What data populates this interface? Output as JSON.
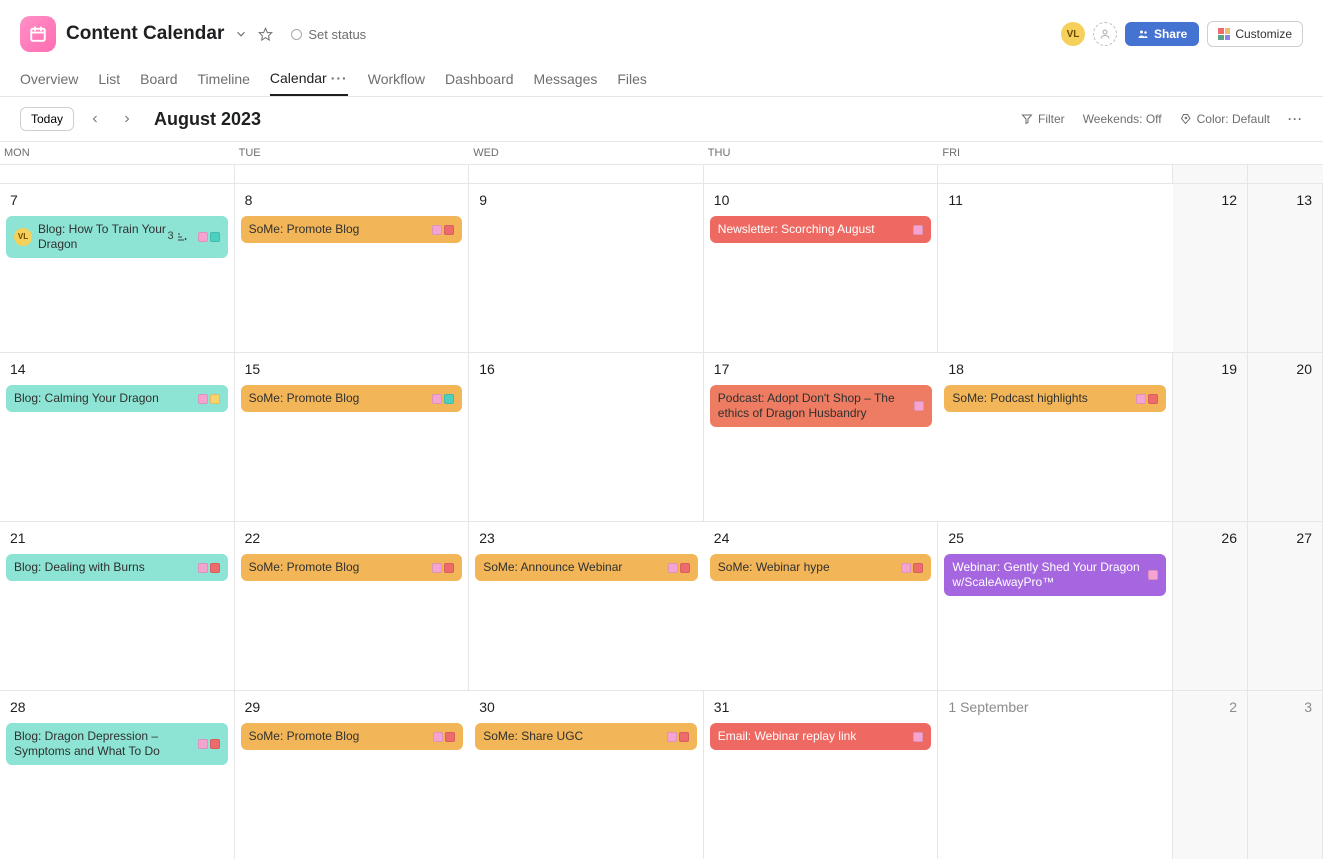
{
  "header": {
    "title": "Content Calendar",
    "status": "Set status",
    "avatar_initials": "VL",
    "share_label": "Share",
    "customize_label": "Customize"
  },
  "tabs": [
    {
      "label": "Overview"
    },
    {
      "label": "List"
    },
    {
      "label": "Board"
    },
    {
      "label": "Timeline"
    },
    {
      "label": "Calendar",
      "active": true
    },
    {
      "label": "Workflow"
    },
    {
      "label": "Dashboard"
    },
    {
      "label": "Messages"
    },
    {
      "label": "Files"
    }
  ],
  "toolbar": {
    "today_label": "Today",
    "month_title": "August 2023",
    "filter_label": "Filter",
    "weekends_label": "Weekends: Off",
    "color_label": "Color: Default"
  },
  "day_headers": [
    "MON",
    "TUE",
    "WED",
    "THU",
    "FRI",
    "",
    ""
  ],
  "weeks": [
    {
      "days": [
        {
          "date": "7",
          "tasks": [
            {
              "title": "Blog: How To Train Your Dragon",
              "color": "teal",
              "assignee": "VL",
              "subcount": "3",
              "chips": [
                "pink",
                "teal"
              ]
            }
          ]
        },
        {
          "date": "8",
          "tasks": [
            {
              "title": "SoMe: Promote Blog",
              "color": "orange",
              "chips": [
                "pink",
                "red"
              ]
            }
          ]
        },
        {
          "date": "9",
          "tasks": []
        },
        {
          "date": "10",
          "tasks": [
            {
              "title": "Newsletter: Scorching August",
              "color": "red",
              "chips": [
                "pink"
              ]
            }
          ]
        },
        {
          "date": "11",
          "tasks": []
        },
        {
          "date": "12",
          "weekend": true,
          "tasks": []
        },
        {
          "date": "13",
          "weekend": true,
          "tasks": []
        }
      ]
    },
    {
      "days": [
        {
          "date": "14",
          "tasks": [
            {
              "title": "Blog: Calming Your Dragon",
              "color": "teal",
              "chips": [
                "pink",
                "yellow"
              ]
            }
          ]
        },
        {
          "date": "15",
          "tasks": [
            {
              "title": "SoMe: Promote Blog",
              "color": "orange",
              "chips": [
                "pink",
                "teal"
              ]
            }
          ]
        },
        {
          "date": "16",
          "tasks": []
        },
        {
          "date": "17",
          "tasks": [
            {
              "title": "Podcast: Adopt Don't Shop – The ethics of Dragon Husbandry",
              "color": "coral",
              "chips": [
                "pink"
              ]
            }
          ]
        },
        {
          "date": "18",
          "tasks": [
            {
              "title": "SoMe: Podcast highlights",
              "color": "orange",
              "chips": [
                "pink",
                "red"
              ]
            }
          ]
        },
        {
          "date": "19",
          "weekend": true,
          "tasks": []
        },
        {
          "date": "20",
          "weekend": true,
          "tasks": []
        }
      ]
    },
    {
      "days": [
        {
          "date": "21",
          "tasks": [
            {
              "title": "Blog: Dealing with Burns",
              "color": "teal",
              "chips": [
                "pink",
                "red"
              ]
            }
          ]
        },
        {
          "date": "22",
          "tasks": [
            {
              "title": "SoMe: Promote Blog",
              "color": "orange",
              "chips": [
                "pink",
                "red"
              ]
            }
          ]
        },
        {
          "date": "23",
          "tasks": [
            {
              "title": "SoMe: Announce Webinar",
              "color": "orange",
              "chips": [
                "pink",
                "red"
              ]
            }
          ]
        },
        {
          "date": "24",
          "tasks": [
            {
              "title": "SoMe: Webinar hype",
              "color": "orange",
              "chips": [
                "pink",
                "red"
              ]
            }
          ]
        },
        {
          "date": "25",
          "tasks": [
            {
              "title": "Webinar: Gently Shed Your Dragon w/ScaleAwayPro™",
              "color": "purple",
              "chips": [
                "pink"
              ]
            }
          ]
        },
        {
          "date": "26",
          "weekend": true,
          "tasks": []
        },
        {
          "date": "27",
          "weekend": true,
          "tasks": []
        }
      ]
    },
    {
      "days": [
        {
          "date": "28",
          "tasks": [
            {
              "title": "Blog: Dragon Depression – Symptoms and What To Do",
              "color": "teal",
              "chips": [
                "pink",
                "red"
              ]
            }
          ]
        },
        {
          "date": "29",
          "tasks": [
            {
              "title": "SoMe: Promote Blog",
              "color": "orange",
              "chips": [
                "pink",
                "red"
              ]
            }
          ]
        },
        {
          "date": "30",
          "tasks": [
            {
              "title": "SoMe: Share UGC",
              "color": "orange",
              "chips": [
                "pink",
                "red"
              ]
            }
          ]
        },
        {
          "date": "31",
          "tasks": [
            {
              "title": "Email: Webinar replay link",
              "color": "red",
              "chips": [
                "pink"
              ]
            }
          ]
        },
        {
          "date": "1 September",
          "muted": true,
          "tasks": []
        },
        {
          "date": "2",
          "weekend": true,
          "muted": true,
          "tasks": []
        },
        {
          "date": "3",
          "weekend": true,
          "muted": true,
          "tasks": []
        }
      ]
    }
  ]
}
